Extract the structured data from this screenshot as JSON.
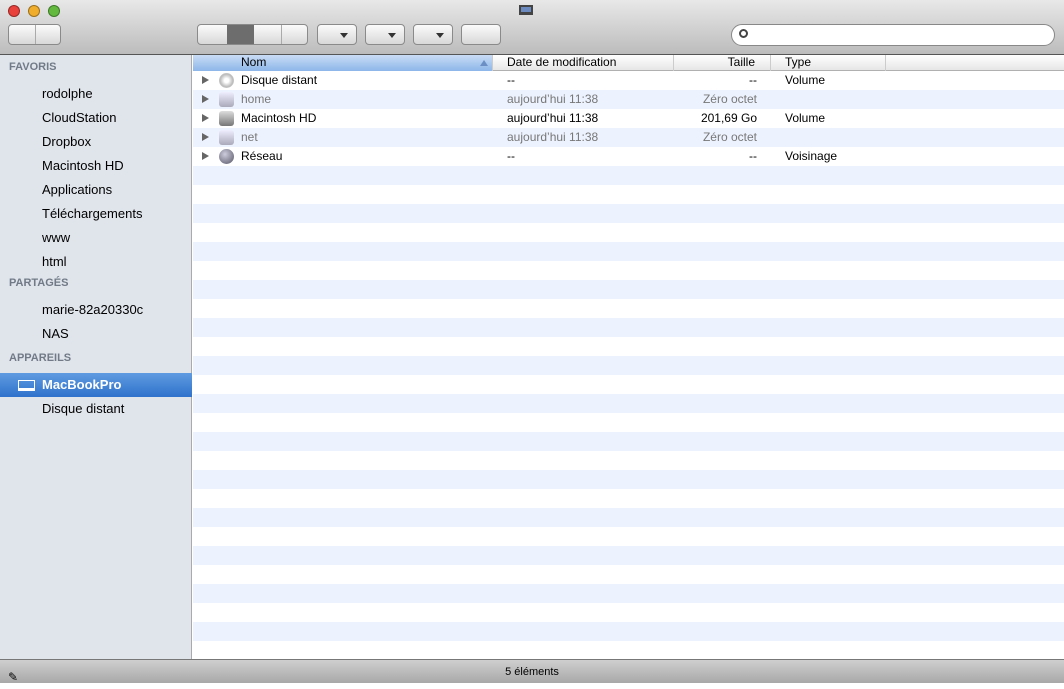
{
  "window": {
    "title_icon": "laptop-icon",
    "status_text": "5 éléments"
  },
  "sidebar": {
    "sections": [
      {
        "title": "FAVORIS",
        "items": [
          "rodolphe",
          "CloudStation",
          "Dropbox",
          "Macintosh HD",
          "Applications",
          "Téléchargements",
          "www",
          "html"
        ]
      },
      {
        "title": "PARTAGÉS",
        "items": [
          "marie-82a20330c",
          "NAS"
        ]
      },
      {
        "title": "APPAREILS",
        "items": [
          "MacBookPro",
          "Disque distant"
        ]
      }
    ],
    "selected": "MacBookPro"
  },
  "columns": [
    "Nom",
    "Date de modification",
    "Taille",
    "Type"
  ],
  "rows": [
    {
      "name": "Disque distant",
      "date": "--",
      "size": "--",
      "type": "Volume",
      "icon": "disc-icon",
      "dim": false
    },
    {
      "name": "home",
      "date": "aujourd’hui 11:38",
      "size": "Zéro octet",
      "type": "",
      "icon": "network-volume-icon",
      "dim": true
    },
    {
      "name": "Macintosh HD",
      "date": "aujourd’hui 11:38",
      "size": "201,69 Go",
      "type": "Volume",
      "icon": "hard-drive-icon",
      "dim": false
    },
    {
      "name": "net",
      "date": "aujourd’hui 11:38",
      "size": "Zéro octet",
      "type": "",
      "icon": "network-volume-icon",
      "dim": true
    },
    {
      "name": "Réseau",
      "date": "--",
      "size": "--",
      "type": "Voisinage",
      "icon": "network-globe-icon",
      "dim": false
    }
  ]
}
